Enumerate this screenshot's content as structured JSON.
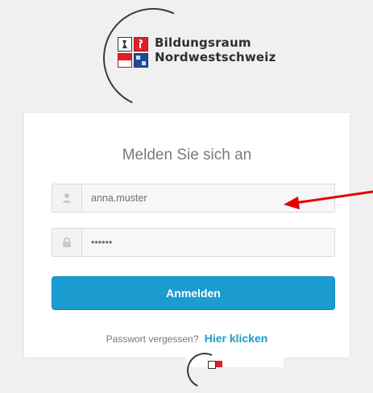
{
  "brand": {
    "name_line1": "Bildungsraum",
    "name_line2": "Nordwestschweiz"
  },
  "login": {
    "title": "Melden Sie sich an",
    "username_value": "anna.muster",
    "password_value": "••••••",
    "submit_label": "Anmelden",
    "forgot_text": "Passwort vergessen?",
    "forgot_link": "Hier klicken"
  },
  "icons": {
    "user": "user-icon",
    "lock": "lock-icon"
  },
  "colors": {
    "primary_button": "#1a9cd0",
    "arrow": "#e60000",
    "logo_red": "#e01f26",
    "logo_blue": "#1f4b96"
  }
}
